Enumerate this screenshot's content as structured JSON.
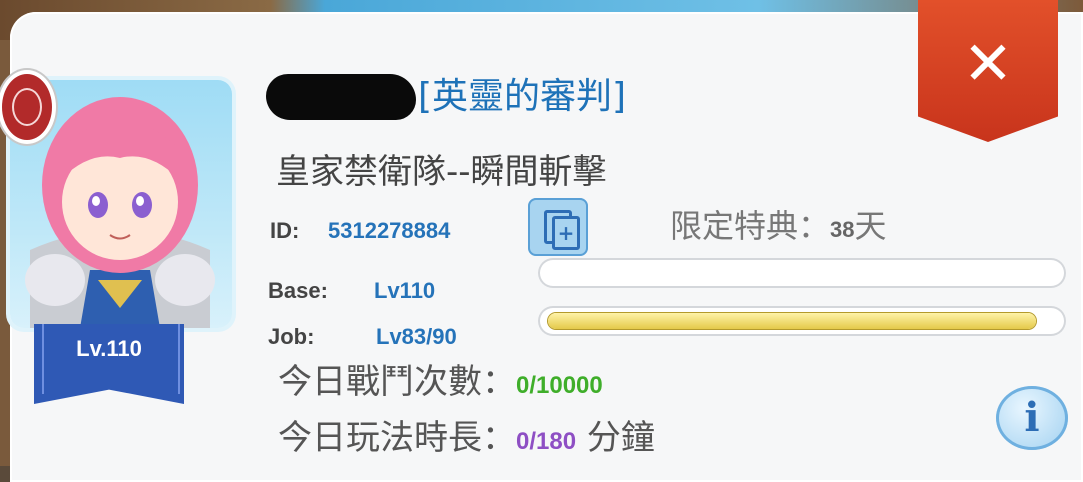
{
  "profile": {
    "title": "[英靈的審判]",
    "guild": "皇家禁衛隊--瞬間斬擊",
    "id_label": "ID:",
    "id_value": "5312278884",
    "limited_label": "限定特典：",
    "limited_days": "38",
    "limited_unit": "天",
    "portrait_level": "Lv.110"
  },
  "levels": {
    "base_label": "Base:",
    "base_value": "Lv110",
    "base_progress": 0.0,
    "job_label": "Job:",
    "job_value": "Lv83/90",
    "job_progress": 0.96
  },
  "stats": {
    "battles_label": "今日戰鬥次數：",
    "battles_value": "0/10000",
    "playtime_label": "今日玩法時長：",
    "playtime_value": "0/180",
    "playtime_unit": "分鐘"
  },
  "buttons": {
    "close_glyph": "✕",
    "info_glyph": "i"
  },
  "colors": {
    "accent_blue": "#2573b9",
    "close_red": "#c8341c",
    "battles_green": "#3fae2a",
    "playtime_purple": "#8e4fc4",
    "xp_yellow": "#e4c94a"
  },
  "icons": {
    "close": "close-icon",
    "copy": "copy-icon",
    "info": "info-icon",
    "guild_badge": "guild-badge-icon"
  }
}
